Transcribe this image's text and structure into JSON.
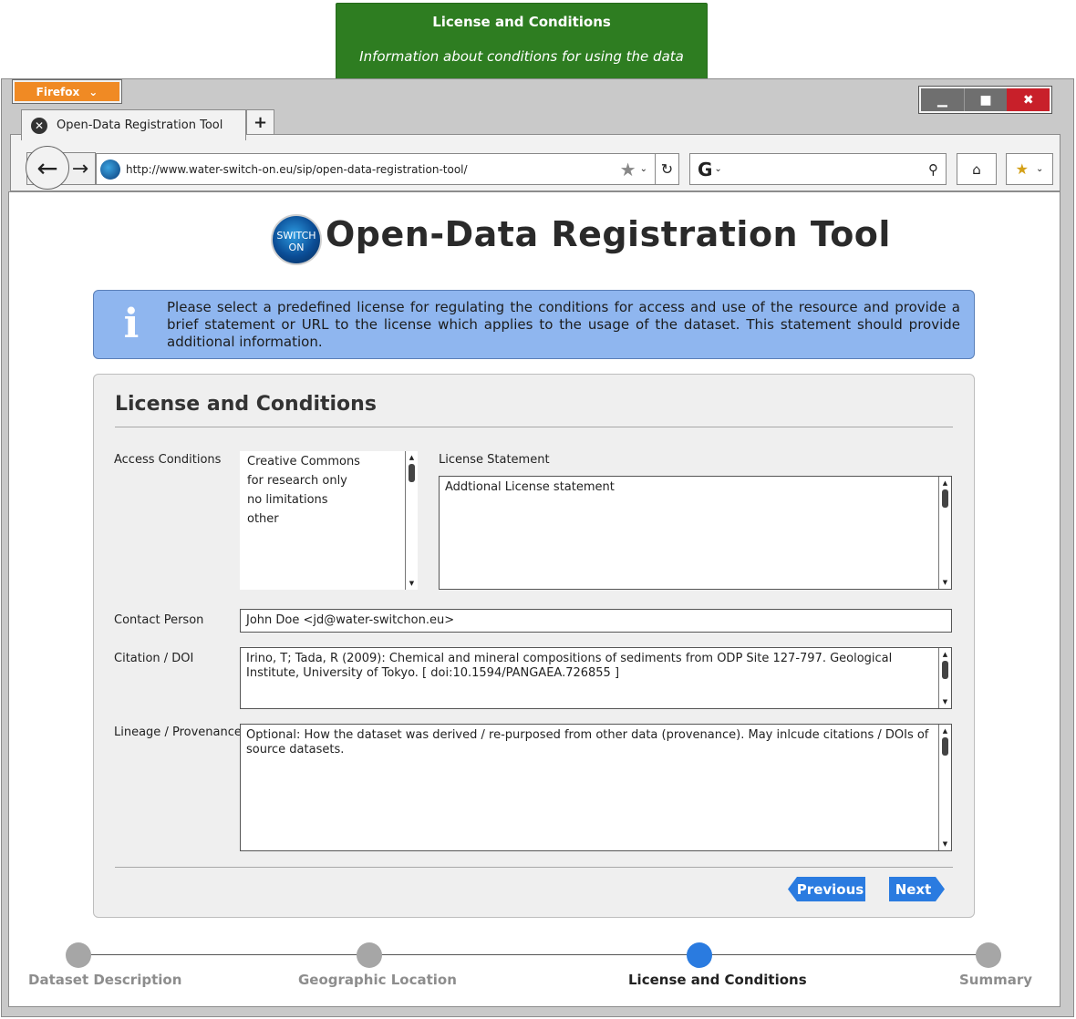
{
  "note": {
    "title": "License and Conditions",
    "subtitle": "Information about conditions for using the data"
  },
  "browser": {
    "menu_label": "Firefox",
    "tab_title": "Open-Data Registration Tool",
    "url": "http://www.water-switch-on.eu/sip/open-data-registration-tool/",
    "logo_text_1": "SWITCH",
    "logo_text_2": "ON",
    "search_engine": "G"
  },
  "page": {
    "title": "Open-Data Registration Tool",
    "info_text": "Please select a predefined license for regulating the conditions for access and use of the resource and provide a brief statement or URL to the license which applies to the usage of the dataset. This statement should provide additional information."
  },
  "form": {
    "section_title": "License and Conditions",
    "access_label": "Access Conditions",
    "access_options": [
      "Creative Commons",
      "for research only",
      "no limitations",
      "other"
    ],
    "license_label": "License Statement",
    "license_value": "Addtional License statement",
    "contact_label": "Contact Person",
    "contact_value": "John Doe <jd@water-switchon.eu>",
    "citation_label": "Citation / DOI",
    "citation_value": "Irino, T; Tada, R (2009): Chemical and mineral compositions of sediments from ODP Site 127-797. Geological Institute, University of Tokyo. [ doi:10.1594/PANGAEA.726855 ]",
    "lineage_label": "Lineage / Provenance",
    "lineage_value": "Optional: How the dataset was derived / re-purposed from other data (provenance). May inlcude citations / DOIs of source datasets.",
    "previous_label": "Previous",
    "next_label": "Next"
  },
  "stepper": {
    "steps": [
      {
        "label": "Dataset Description",
        "active": false
      },
      {
        "label": "Geographic Location",
        "active": false
      },
      {
        "label": "License and Conditions",
        "active": true
      },
      {
        "label": "Summary",
        "active": false
      }
    ]
  },
  "colors": {
    "note_bg": "#2e7d21",
    "info_bg": "#8fb6ef",
    "accent": "#2a7be0",
    "firefox_orange": "#f08a24",
    "close_red": "#c8202a"
  }
}
